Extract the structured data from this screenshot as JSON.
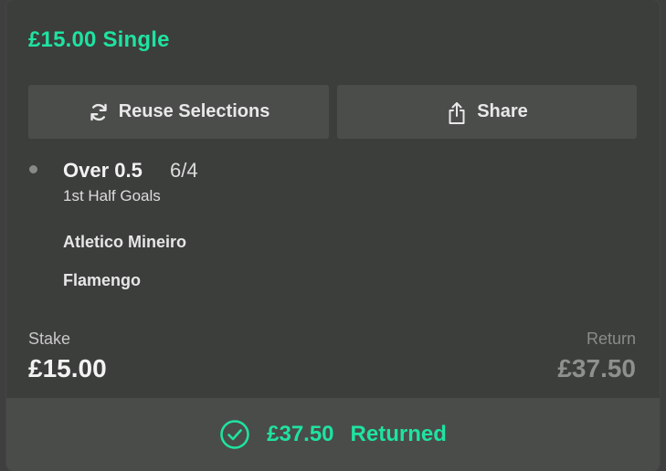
{
  "bet": {
    "title": "£15.00 Single"
  },
  "actions": {
    "reuse_label": "Reuse Selections",
    "reuse_icon": "refresh-icon",
    "share_label": "Share",
    "share_icon": "share-icon"
  },
  "selection": {
    "name": "Over 0.5",
    "odds": "6/4",
    "market": "1st Half Goals",
    "teams": [
      "Atletico Mineiro",
      "Flamengo"
    ]
  },
  "stake": {
    "label": "Stake",
    "value": "£15.00"
  },
  "return": {
    "label": "Return",
    "value": "£37.50"
  },
  "result": {
    "icon": "check-circle-icon",
    "amount": "£37.50",
    "status": "Returned"
  },
  "colors": {
    "accent": "#1fe3a0",
    "card_bg": "#3c3e3c",
    "button_bg": "#4b4d4b",
    "footer_bg": "#4a4c4a"
  }
}
